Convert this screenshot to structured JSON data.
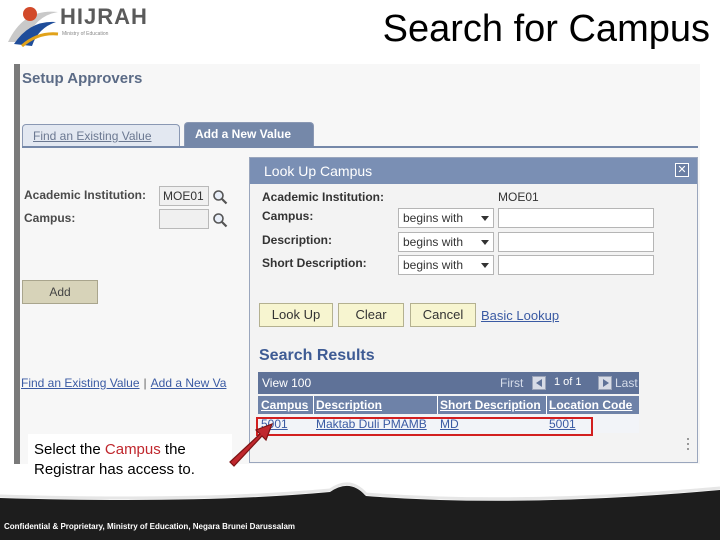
{
  "slide": {
    "title": "Search for Campus",
    "logo_text": "HIJRAH",
    "logo_sub": "Ministry of Education",
    "footer": "Confidential & Proprietary, Ministry of Education, Negara Brunei Darussalam"
  },
  "page": {
    "title": "Setup Approvers",
    "tabs": [
      {
        "label": "Find an Existing Value"
      },
      {
        "label": "Add a New Value"
      }
    ],
    "fields": {
      "academic_institution_label": "Academic Institution:",
      "academic_institution_value": "MOE01",
      "campus_label": "Campus:",
      "campus_value": ""
    },
    "add_button": "Add",
    "bottom_links": {
      "find": "Find an Existing Value",
      "add": "Add a New Va"
    }
  },
  "lookup": {
    "title": "Look Up Campus",
    "close": "✕",
    "academic_institution_label": "Academic Institution:",
    "academic_institution_value": "MOE01",
    "rows": [
      {
        "label": "Campus:",
        "operator": "begins with",
        "value": ""
      },
      {
        "label": "Description:",
        "operator": "begins with",
        "value": ""
      },
      {
        "label": "Short Description:",
        "operator": "begins with",
        "value": ""
      }
    ],
    "buttons": {
      "lookup": "Look Up",
      "clear": "Clear",
      "cancel": "Cancel",
      "basic_lookup": "Basic Lookup"
    },
    "results_title": "Search Results",
    "grid_nav": {
      "view": "View 100",
      "first": "First",
      "count": "1 of 1",
      "last": "Last"
    },
    "columns": [
      "Campus",
      "Description",
      "Short Description",
      "Location Code"
    ],
    "results": [
      {
        "campus": "5001",
        "description": "Maktab Duli PMAMB",
        "short_description": "MD",
        "location_code": "5001"
      }
    ]
  },
  "callout": {
    "before": "Select the ",
    "highlight": "Campus",
    "after": " the Registrar has access to."
  },
  "colors": {
    "accent_red": "#d21f1f",
    "header_blue": "#7a8fb4",
    "link_blue": "#3a5aa3"
  }
}
